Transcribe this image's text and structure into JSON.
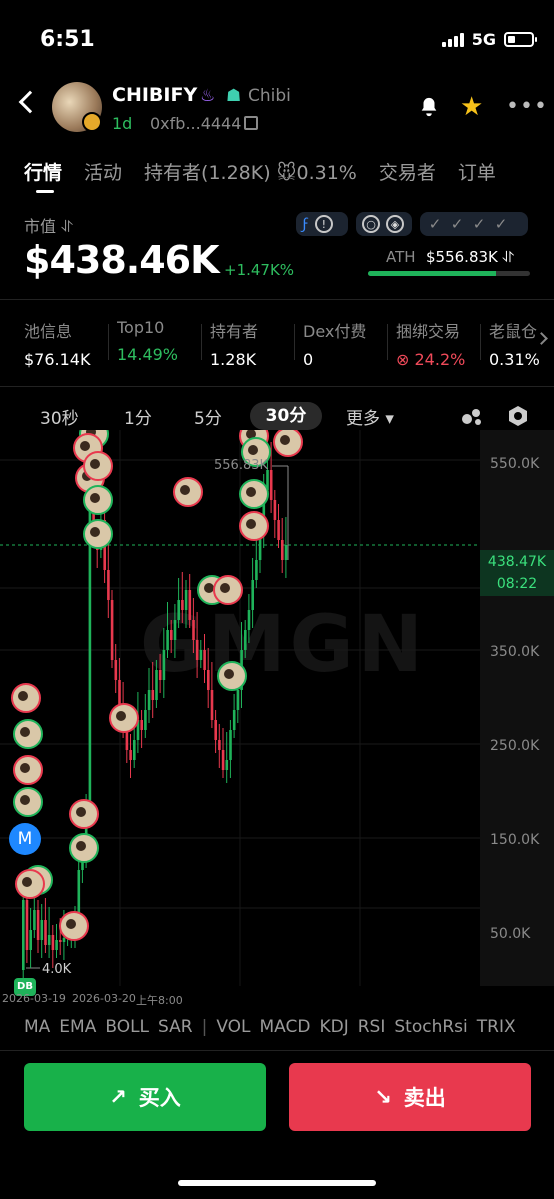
{
  "status": {
    "time": "6:51",
    "network": "5G"
  },
  "token": {
    "name": "CHIBIFY",
    "tag": "Chibi",
    "age": "1d",
    "address": "0xfb...4444"
  },
  "icons": {
    "back": "chevron-left-icon",
    "bell": "bell-icon",
    "star": "star-icon",
    "more": "more-icon",
    "flame": "flame-icon",
    "robot": "robot-icon",
    "copy": "copy-icon"
  },
  "tabs": [
    "行情",
    "活动",
    "持有者(1.28K)",
    "0.31%",
    "交易者",
    "订单"
  ],
  "market": {
    "label": "市值 ⥯",
    "value": "$438.46K",
    "change": "+1.47K%",
    "ath_label": "ATH",
    "ath_value": "$556.83K ⥯",
    "ath_progress": 0.79
  },
  "info": [
    {
      "k": "池信息",
      "v": "$76.14K",
      "color": "#ffffff"
    },
    {
      "k": "Top10",
      "v": "14.49%",
      "color": "#2ebd5f"
    },
    {
      "k": "持有者",
      "v": "1.28K",
      "color": "#ffffff"
    },
    {
      "k": "Dex付费",
      "v": "0",
      "color": "#ffffff"
    },
    {
      "k": "捆绑交易",
      "v": "⊗ 24.2%",
      "color": "#f04a5a"
    },
    {
      "k": "老鼠仓",
      "v": "0.31%",
      "color": "#ffffff"
    }
  ],
  "timeframes": {
    "t1": "30秒",
    "t2": "1分",
    "t3": "5分",
    "active": "30分",
    "more": "更多 ▾"
  },
  "chart_data": {
    "type": "candlestick",
    "y_ticks": [
      "550.0K",
      "350.0K",
      "250.0K",
      "150.0K",
      "50.0K"
    ],
    "current_price": "438.47K",
    "countdown": "08:22",
    "high_label": "556.83K",
    "low_label": "4.0K",
    "date_labels": [
      "2026-03-19",
      "2026-03-20",
      "上午8:00"
    ]
  },
  "indicators": [
    "MA",
    "EMA",
    "BOLL",
    "SAR",
    "|",
    "VOL",
    "MACD",
    "KDJ",
    "RSI",
    "StochRsi",
    "TRIX"
  ],
  "badges": {
    "db": "DB",
    "m": "M"
  },
  "actions": {
    "buy": "买入",
    "sell": "卖出"
  },
  "colors": {
    "up": "#1fb35a",
    "down": "#e8394e",
    "star": "#f7c21a"
  }
}
